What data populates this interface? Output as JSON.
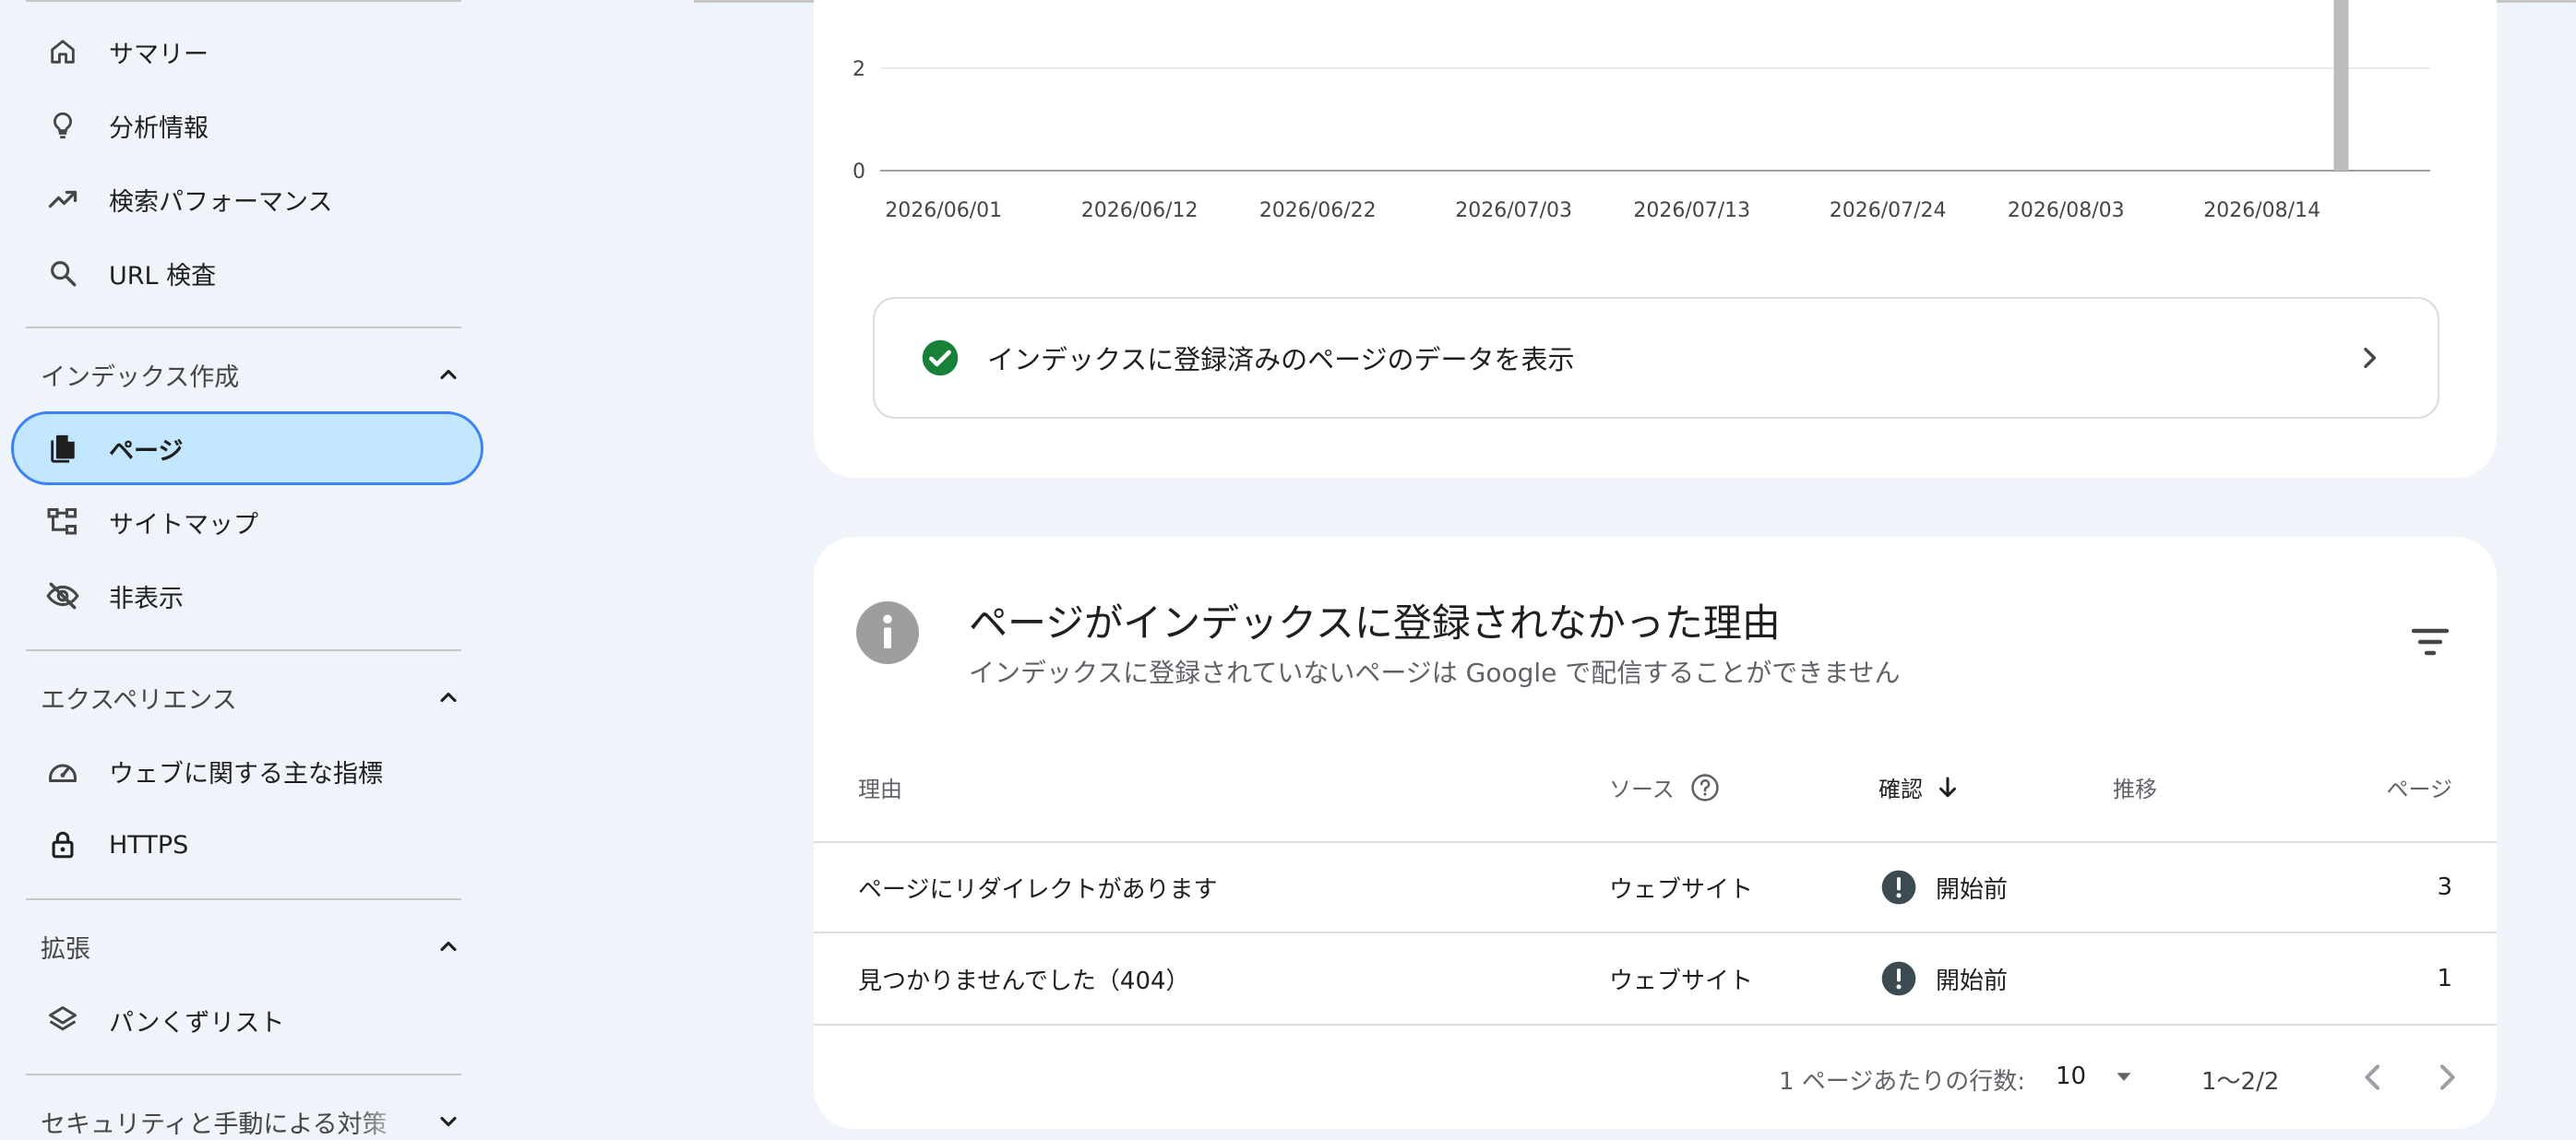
{
  "sidebar": {
    "items_top": [
      {
        "label": "サマリー",
        "icon": "home-icon"
      },
      {
        "label": "分析情報",
        "icon": "lightbulb-icon"
      },
      {
        "label": "検索パフォーマンス",
        "icon": "trending-up-icon"
      },
      {
        "label": "URL 検査",
        "icon": "search-icon"
      }
    ],
    "sections": [
      {
        "header": "インデックス作成",
        "items": [
          {
            "label": "ページ",
            "icon": "pages-icon",
            "active": true
          },
          {
            "label": "サイトマップ",
            "icon": "sitemap-icon"
          },
          {
            "label": "非表示",
            "icon": "eye-off-icon"
          }
        ]
      },
      {
        "header": "エクスペリエンス",
        "items": [
          {
            "label": "ウェブに関する主な指標",
            "icon": "gauge-icon"
          },
          {
            "label": "HTTPS",
            "icon": "lock-icon"
          }
        ]
      },
      {
        "header": "拡張",
        "items": [
          {
            "label": "パンくずリスト",
            "icon": "layers-icon"
          }
        ]
      },
      {
        "header": "セキュリティと手動による対策",
        "items": []
      }
    ]
  },
  "chart_data": {
    "type": "bar",
    "y_ticks": [
      0,
      2
    ],
    "x_ticks": [
      "2026/06/01",
      "2026/06/12",
      "2026/06/22",
      "2026/07/03",
      "2026/07/13",
      "2026/07/24",
      "2026/08/03",
      "2026/08/14"
    ],
    "series": [
      {
        "values": [
          {
            "x": "2026/08/21",
            "y": 4
          }
        ]
      }
    ],
    "colors": {
      "bar": "#bdbdbd",
      "grid": "#e6e6e6",
      "axis": "#9e9e9e"
    }
  },
  "index_link": {
    "label": "インデックスに登録済みのページのデータを表示"
  },
  "reasons": {
    "title": "ページがインデックスに登録されなかった理由",
    "subtitle": "インデックスに登録されていないページは Google で配信することができません",
    "columns": {
      "reason": "理由",
      "source": "ソース",
      "validation": "確認",
      "trend": "推移",
      "pages": "ページ"
    },
    "rows": [
      {
        "reason": "ページにリダイレクトがあります",
        "source": "ウェブサイト",
        "validation": "開始前",
        "pages": "3"
      },
      {
        "reason": "見つかりませんでした（404）",
        "source": "ウェブサイト",
        "validation": "開始前",
        "pages": "1"
      }
    ],
    "footer": {
      "rows_per_page_label": "1 ページあたりの行数:",
      "rows_per_page_value": "10",
      "range": "1〜2/2"
    }
  },
  "colors": {
    "accent": "#3b82f6",
    "active_bg": "#c2e7ff",
    "success": "#188038",
    "status_dark": "#3c4a52"
  }
}
